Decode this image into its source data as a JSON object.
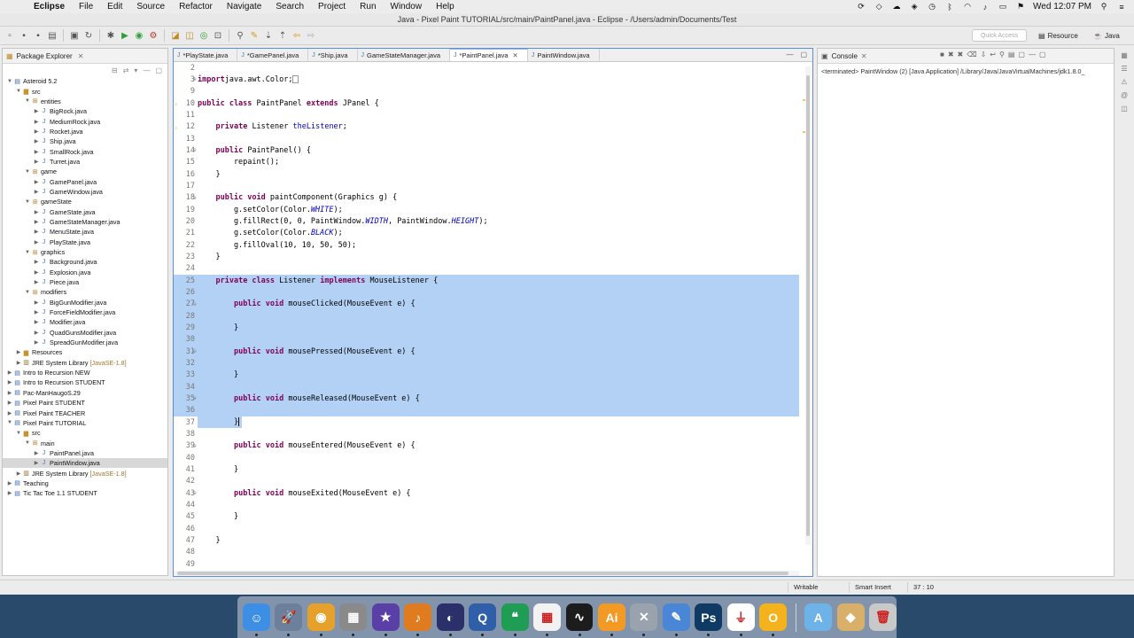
{
  "menubar": {
    "app_name": "Eclipse",
    "menus": [
      "File",
      "Edit",
      "Source",
      "Refactor",
      "Navigate",
      "Search",
      "Project",
      "Run",
      "Window",
      "Help"
    ],
    "clock": "Wed 12:07 PM"
  },
  "window": {
    "title": "Java - Pixel Paint TUTORIAL/src/main/PaintPanel.java - Eclipse - /Users/admin/Documents/Test"
  },
  "toolbar": {
    "quick_access_placeholder": "Quick Access",
    "perspective_resource": "Resource",
    "perspective_java": "Java"
  },
  "package_explorer": {
    "title": "Package Explorer",
    "nodes": [
      {
        "label": "Asteroid 5.2",
        "depth": 0,
        "icon": "project-icon",
        "open": true
      },
      {
        "label": "src",
        "depth": 1,
        "icon": "folder-icon",
        "open": true
      },
      {
        "label": "entities",
        "depth": 2,
        "icon": "package-icon",
        "open": true
      },
      {
        "label": "BigRock.java",
        "depth": 3,
        "icon": "java-file-icon"
      },
      {
        "label": "MediumRock.java",
        "depth": 3,
        "icon": "java-file-icon"
      },
      {
        "label": "Rocket.java",
        "depth": 3,
        "icon": "java-file-icon"
      },
      {
        "label": "Ship.java",
        "depth": 3,
        "icon": "java-file-icon"
      },
      {
        "label": "SmallRock.java",
        "depth": 3,
        "icon": "java-file-icon"
      },
      {
        "label": "Turret.java",
        "depth": 3,
        "icon": "java-file-icon"
      },
      {
        "label": "game",
        "depth": 2,
        "icon": "package-icon",
        "open": true
      },
      {
        "label": "GamePanel.java",
        "depth": 3,
        "icon": "java-file-icon"
      },
      {
        "label": "GameWindow.java",
        "depth": 3,
        "icon": "java-file-icon"
      },
      {
        "label": "gameState",
        "depth": 2,
        "icon": "package-icon",
        "open": true
      },
      {
        "label": "GameState.java",
        "depth": 3,
        "icon": "java-file-icon"
      },
      {
        "label": "GameStateManager.java",
        "depth": 3,
        "icon": "java-file-icon"
      },
      {
        "label": "MenuState.java",
        "depth": 3,
        "icon": "java-file-icon"
      },
      {
        "label": "PlayState.java",
        "depth": 3,
        "icon": "java-file-icon"
      },
      {
        "label": "graphics",
        "depth": 2,
        "icon": "package-icon",
        "open": true
      },
      {
        "label": "Background.java",
        "depth": 3,
        "icon": "java-file-icon"
      },
      {
        "label": "Explosion.java",
        "depth": 3,
        "icon": "java-file-icon"
      },
      {
        "label": "Piece.java",
        "depth": 3,
        "icon": "java-file-icon"
      },
      {
        "label": "modifiers",
        "depth": 2,
        "icon": "package-icon",
        "open": true
      },
      {
        "label": "BigGunModifier.java",
        "depth": 3,
        "icon": "java-file-icon"
      },
      {
        "label": "ForceFieldModifier.java",
        "depth": 3,
        "icon": "java-file-icon"
      },
      {
        "label": "Modifier.java",
        "depth": 3,
        "icon": "java-file-icon"
      },
      {
        "label": "QuadGunsModifier.java",
        "depth": 3,
        "icon": "java-file-icon"
      },
      {
        "label": "SpreadGunModifier.java",
        "depth": 3,
        "icon": "java-file-icon"
      },
      {
        "label": "Resources",
        "depth": 1,
        "icon": "folder-icon"
      },
      {
        "label": "JRE System Library",
        "suffix": "[JavaSE-1.8]",
        "depth": 1,
        "icon": "library-icon"
      },
      {
        "label": "Intro to Recursion NEW",
        "depth": 0,
        "icon": "project-icon"
      },
      {
        "label": "Intro to Recursion STUDENT",
        "depth": 0,
        "icon": "project-icon"
      },
      {
        "label": "Pac-ManHaugoS.29",
        "depth": 0,
        "icon": "project-icon"
      },
      {
        "label": "Pixel Paint STUDENT",
        "depth": 0,
        "icon": "project-icon"
      },
      {
        "label": "Pixel Paint TEACHER",
        "depth": 0,
        "icon": "project-icon"
      },
      {
        "label": "Pixel Paint TUTORIAL",
        "depth": 0,
        "icon": "project-icon",
        "open": true
      },
      {
        "label": "src",
        "depth": 1,
        "icon": "folder-icon",
        "open": true
      },
      {
        "label": "main",
        "depth": 2,
        "icon": "package-icon",
        "open": true
      },
      {
        "label": "PaintPanel.java",
        "depth": 3,
        "icon": "java-file-icon"
      },
      {
        "label": "PaintWindow.java",
        "depth": 3,
        "icon": "java-file-icon",
        "selected": true
      },
      {
        "label": "JRE System Library",
        "suffix": "[JavaSE-1.8]",
        "depth": 1,
        "icon": "library-icon"
      },
      {
        "label": "Teaching",
        "depth": 0,
        "icon": "project-icon"
      },
      {
        "label": "Tic Tac Toe 1.1 STUDENT",
        "depth": 0,
        "icon": "project-icon"
      }
    ]
  },
  "editor": {
    "tabs": [
      {
        "label": "*PlayState.java",
        "active": false
      },
      {
        "label": "*GamePanel.java",
        "active": false
      },
      {
        "label": "*Ship.java",
        "active": false
      },
      {
        "label": "GameStateManager.java",
        "active": false
      },
      {
        "label": "*PaintPanel.java",
        "active": true
      },
      {
        "label": "PaintWindow.java",
        "active": false
      }
    ],
    "lines": [
      {
        "n": "2",
        "tokens": []
      },
      {
        "n": "3",
        "fold": "+",
        "tokens": [
          [
            "kw",
            "import"
          ],
          [
            "",
            "java.awt.Color;"
          ],
          [
            "box",
            ""
          ]
        ]
      },
      {
        "n": "9",
        "tokens": []
      },
      {
        "n": "10",
        "marker": true,
        "tokens": [
          [
            "kw",
            "public class "
          ],
          [
            "",
            "PaintPanel "
          ],
          [
            "kw",
            "extends "
          ],
          [
            "",
            "JPanel {"
          ]
        ]
      },
      {
        "n": "11",
        "tokens": []
      },
      {
        "n": "12",
        "marker": true,
        "tokens": [
          [
            "",
            "    "
          ],
          [
            "kw",
            "private "
          ],
          [
            "",
            "Listener "
          ],
          [
            "fld",
            "theListener"
          ],
          [
            "",
            ";"
          ]
        ]
      },
      {
        "n": "13",
        "tokens": []
      },
      {
        "n": "14",
        "fold": "-",
        "tokens": [
          [
            "",
            "    "
          ],
          [
            "kw",
            "public "
          ],
          [
            "",
            "PaintPanel() {"
          ]
        ]
      },
      {
        "n": "15",
        "tokens": [
          [
            "",
            "        repaint();"
          ]
        ]
      },
      {
        "n": "16",
        "tokens": [
          [
            "",
            "    }"
          ]
        ]
      },
      {
        "n": "17",
        "tokens": []
      },
      {
        "n": "18",
        "fold": "-",
        "tokens": [
          [
            "",
            "    "
          ],
          [
            "kw",
            "public void "
          ],
          [
            "",
            "paintComponent(Graphics g) {"
          ]
        ]
      },
      {
        "n": "19",
        "tokens": [
          [
            "",
            "        g.setColor(Color."
          ],
          [
            "cst",
            "WHITE"
          ],
          [
            "",
            ");"
          ]
        ]
      },
      {
        "n": "20",
        "tokens": [
          [
            "",
            "        g.fillRect(0, 0, PaintWindow."
          ],
          [
            "cst",
            "WIDTH"
          ],
          [
            "",
            ", PaintWindow."
          ],
          [
            "cst",
            "HEIGHT"
          ],
          [
            "",
            ");"
          ]
        ]
      },
      {
        "n": "21",
        "tokens": [
          [
            "",
            "        g.setColor(Color."
          ],
          [
            "cst",
            "BLACK"
          ],
          [
            "",
            ");"
          ]
        ]
      },
      {
        "n": "22",
        "tokens": [
          [
            "",
            "        g.fillOval(10, 10, 50, 50);"
          ]
        ]
      },
      {
        "n": "23",
        "tokens": [
          [
            "",
            "    }"
          ]
        ]
      },
      {
        "n": "24",
        "tokens": []
      },
      {
        "n": "25",
        "hl": true,
        "tokens": [
          [
            "",
            "    "
          ],
          [
            "kw",
            "private class "
          ],
          [
            "",
            "Listener "
          ],
          [
            "kw",
            "implements "
          ],
          [
            "",
            "MouseListener {"
          ]
        ]
      },
      {
        "n": "26",
        "hl": true,
        "tokens": []
      },
      {
        "n": "27",
        "hl": true,
        "fold": "-",
        "tokens": [
          [
            "",
            "        "
          ],
          [
            "kw",
            "public void "
          ],
          [
            "",
            "mouseClicked(MouseEvent e) {"
          ]
        ]
      },
      {
        "n": "28",
        "hl": true,
        "tokens": []
      },
      {
        "n": "29",
        "hl": true,
        "tokens": [
          [
            "",
            "        }"
          ]
        ]
      },
      {
        "n": "30",
        "hl": true,
        "tokens": []
      },
      {
        "n": "31",
        "hl": true,
        "fold": "-",
        "tokens": [
          [
            "",
            "        "
          ],
          [
            "kw",
            "public void "
          ],
          [
            "",
            "mousePressed(MouseEvent e) {"
          ]
        ]
      },
      {
        "n": "32",
        "hl": true,
        "tokens": []
      },
      {
        "n": "33",
        "hl": true,
        "tokens": [
          [
            "",
            "        }"
          ]
        ]
      },
      {
        "n": "34",
        "hl": true,
        "tokens": []
      },
      {
        "n": "35",
        "hl": true,
        "fold": "-",
        "tokens": [
          [
            "",
            "        "
          ],
          [
            "kw",
            "public void "
          ],
          [
            "",
            "mouseReleased(MouseEvent e) {"
          ]
        ]
      },
      {
        "n": "36",
        "hl": true,
        "tokens": []
      },
      {
        "n": "37",
        "hlpart": true,
        "tokens": [
          [
            "",
            "        }"
          ],
          [
            "cursor",
            ""
          ]
        ]
      },
      {
        "n": "38",
        "tokens": []
      },
      {
        "n": "39",
        "fold": "-",
        "tokens": [
          [
            "",
            "        "
          ],
          [
            "kw",
            "public void "
          ],
          [
            "",
            "mouseEntered(MouseEvent e) {"
          ]
        ]
      },
      {
        "n": "40",
        "tokens": []
      },
      {
        "n": "41",
        "tokens": [
          [
            "",
            "        }"
          ]
        ]
      },
      {
        "n": "42",
        "tokens": []
      },
      {
        "n": "43",
        "fold": "-",
        "tokens": [
          [
            "",
            "        "
          ],
          [
            "kw",
            "public void "
          ],
          [
            "",
            "mouseExited(MouseEvent e) {"
          ]
        ]
      },
      {
        "n": "44",
        "tokens": []
      },
      {
        "n": "45",
        "tokens": [
          [
            "",
            "        }"
          ]
        ]
      },
      {
        "n": "46",
        "tokens": []
      },
      {
        "n": "47",
        "tokens": [
          [
            "",
            "    }"
          ]
        ]
      },
      {
        "n": "48",
        "tokens": []
      },
      {
        "n": "49",
        "tokens": []
      }
    ]
  },
  "console": {
    "title": "Console",
    "status_line": "<terminated> PaintWindow (2) [Java Application] /Library/Java/JavaVirtualMachines/jdk1.8.0_"
  },
  "statusbar": {
    "writable": "Writable",
    "insert_mode": "Smart Insert",
    "position": "37 : 10"
  },
  "dock": {
    "apps": [
      {
        "name": "finder-icon",
        "color": "#3d8fe6",
        "glyph": "☺"
      },
      {
        "name": "launchpad-icon",
        "color": "#6c7f9b",
        "glyph": "🚀"
      },
      {
        "name": "chrome-icon",
        "color": "#e5a12a",
        "glyph": "◉"
      },
      {
        "name": "calculator-icon",
        "color": "#8a8a8a",
        "glyph": "▦"
      },
      {
        "name": "imovie-star-icon",
        "color": "#5a3fa6",
        "glyph": "★"
      },
      {
        "name": "garageband-icon",
        "color": "#e07b1f",
        "glyph": "♪"
      },
      {
        "name": "eclipse-icon",
        "color": "#2b2f6a",
        "glyph": "◐"
      },
      {
        "name": "quicktime-icon",
        "color": "#2e5fa8",
        "glyph": "Q"
      },
      {
        "name": "hangouts-icon",
        "color": "#1f9d55",
        "glyph": "❝"
      },
      {
        "name": "photos-grid-icon",
        "color": "#f2f2f2",
        "glyph": "▦"
      },
      {
        "name": "activity-monitor-icon",
        "color": "#1c1c1c",
        "glyph": "∿"
      },
      {
        "name": "illustrator-icon",
        "color": "#f29a24",
        "glyph": "Ai"
      },
      {
        "name": "system-tools-icon",
        "color": "#9aa3ad",
        "glyph": "✕"
      },
      {
        "name": "textedit-icon",
        "color": "#4a86d6",
        "glyph": "✎"
      },
      {
        "name": "photoshop-icon",
        "color": "#0f3a63",
        "glyph": "Ps"
      },
      {
        "name": "acrobat-icon",
        "color": "#ffffff",
        "glyph": "⏚"
      },
      {
        "name": "outlook-icon",
        "color": "#f4b21d",
        "glyph": "O"
      },
      {
        "name": "applications-folder-icon",
        "color": "#6db3e8",
        "glyph": "A"
      },
      {
        "name": "archive-icon",
        "color": "#d8b06a",
        "glyph": "◆"
      },
      {
        "name": "trash-icon",
        "color": "#c9c9c9",
        "glyph": "🗑"
      }
    ]
  }
}
